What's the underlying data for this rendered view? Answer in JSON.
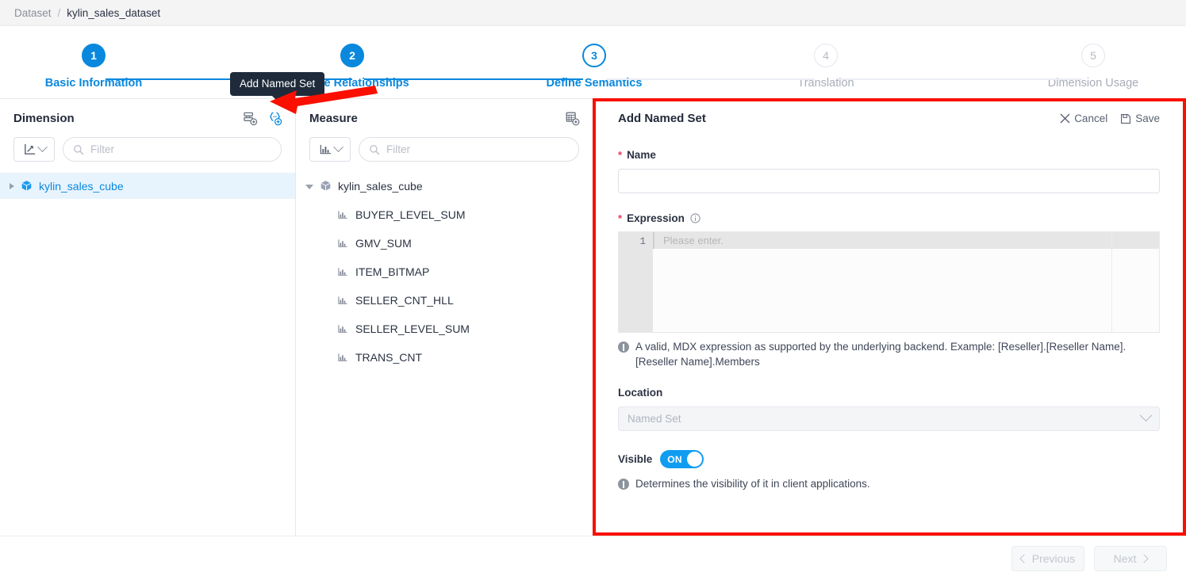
{
  "breadcrumb": {
    "root": "Dataset",
    "separator": "/",
    "current": "kylin_sales_dataset"
  },
  "stepper": {
    "steps": [
      {
        "number": "1",
        "label": "Basic Information",
        "state": "done"
      },
      {
        "number": "2",
        "label": "Define Relationships",
        "state": "done"
      },
      {
        "number": "3",
        "label": "Define Semantics",
        "state": "active"
      },
      {
        "number": "4",
        "label": "Translation",
        "state": "todo"
      },
      {
        "number": "5",
        "label": "Dimension Usage",
        "state": "todo"
      }
    ]
  },
  "tooltip": {
    "text": "Add Named Set"
  },
  "dimension_panel": {
    "title": "Dimension",
    "icons": [
      {
        "name": "add-dimension-table-icon",
        "state": "default"
      },
      {
        "name": "add-named-set-icon",
        "state": "active"
      }
    ],
    "type_filter": {
      "icon": "axis-chart-icon",
      "value": ""
    },
    "search": {
      "placeholder": "Filter",
      "value": ""
    },
    "tree": [
      {
        "label": "kylin_sales_cube",
        "icon": "cube-icon",
        "expanded": false,
        "selected": true
      }
    ]
  },
  "measure_panel": {
    "title": "Measure",
    "icons": [
      {
        "name": "add-calculated-measure-icon",
        "state": "default"
      }
    ],
    "type_filter": {
      "icon": "bar-chart-icon",
      "value": ""
    },
    "search": {
      "placeholder": "Filter",
      "value": ""
    },
    "tree": {
      "root": {
        "label": "kylin_sales_cube",
        "icon": "cube-icon",
        "expanded": true
      },
      "children": [
        "BUYER_LEVEL_SUM",
        "GMV_SUM",
        "ITEM_BITMAP",
        "SELLER_CNT_HLL",
        "SELLER_LEVEL_SUM",
        "TRANS_CNT"
      ]
    }
  },
  "form": {
    "title": "Add Named Set",
    "cancel_label": "Cancel",
    "save_label": "Save",
    "name_field": {
      "label": "Name",
      "required": true,
      "value": "",
      "placeholder": ""
    },
    "expression_field": {
      "label": "Expression",
      "required": true,
      "line_number": "1",
      "placeholder": "Please enter.",
      "value": "",
      "hint": "A valid, MDX expression as supported by the underlying backend. Example: [Reseller].[Reseller Name].[Reseller Name].Members"
    },
    "location_field": {
      "label": "Location",
      "value": "Named Set",
      "disabled": true
    },
    "visible_field": {
      "label": "Visible",
      "toggle_text": "ON",
      "state": "on",
      "hint": "Determines the visibility of it in client applications."
    }
  },
  "footer": {
    "previous_label": "Previous",
    "next_label": "Next"
  },
  "colors": {
    "accent": "#0988de",
    "toggle_on": "#109cf1",
    "required_star": "#f0365e",
    "highlight_box": "#fa0f00",
    "tooltip_bg": "#1f2b3a",
    "row_selected_bg": "#e8f4fd"
  }
}
